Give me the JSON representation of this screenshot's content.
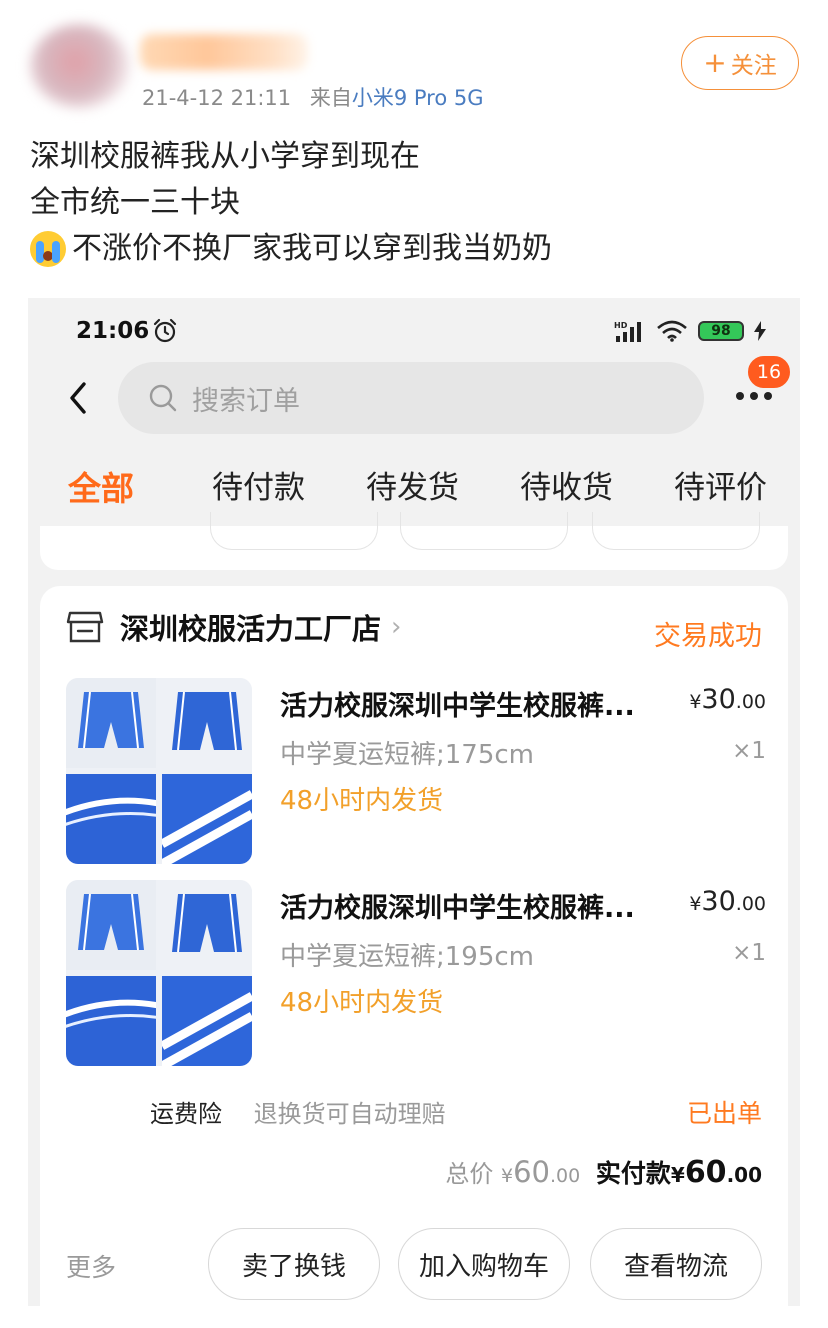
{
  "post": {
    "timestamp": "21-4-12 21:11",
    "via_prefix": "来自",
    "device": "小米9 Pro 5G",
    "follow_label": "关注",
    "lines": [
      "深圳校服裤我从小学穿到现在",
      "全市统一三十块",
      "不涨价不换厂家我可以穿到我当奶奶"
    ]
  },
  "screenshot": {
    "status_bar": {
      "time": "21:06",
      "battery": "98"
    },
    "search": {
      "placeholder": "搜索订单"
    },
    "more_badge": "16",
    "tabs": [
      "全部",
      "待付款",
      "待发货",
      "待收货",
      "待评价"
    ],
    "active_tab": 0,
    "order": {
      "shop_name": "深圳校服活力工厂店",
      "status": "交易成功",
      "items": [
        {
          "title": "活力校服深圳中学生校服裤...",
          "spec": "中学夏运短裤;175cm",
          "shipping": "48小时内发货",
          "currency": "¥",
          "price_int": "30",
          "price_dec": ".00",
          "qty": "×1"
        },
        {
          "title": "活力校服深圳中学生校服裤...",
          "spec": "中学夏运短裤;195cm",
          "shipping": "48小时内发货",
          "currency": "¥",
          "price_int": "30",
          "price_dec": ".00",
          "qty": "×1"
        }
      ],
      "insurance_label": "运费险",
      "insurance_desc": "退换货可自动理赔",
      "insurance_status": "已出单",
      "total_label": "总价",
      "total_currency": "¥",
      "total_int": "60",
      "total_dec": ".00",
      "paid_label": "实付款",
      "paid_currency": "¥",
      "paid_int": "60",
      "paid_dec": ".00",
      "more_label": "更多",
      "actions": [
        "卖了换钱",
        "加入购物车",
        "查看物流"
      ]
    },
    "colors": {
      "accent": "#ff6a1a",
      "badge": "#ff5b1f",
      "shipping": "#f2a02a",
      "device_link": "#4a7cc0"
    }
  }
}
